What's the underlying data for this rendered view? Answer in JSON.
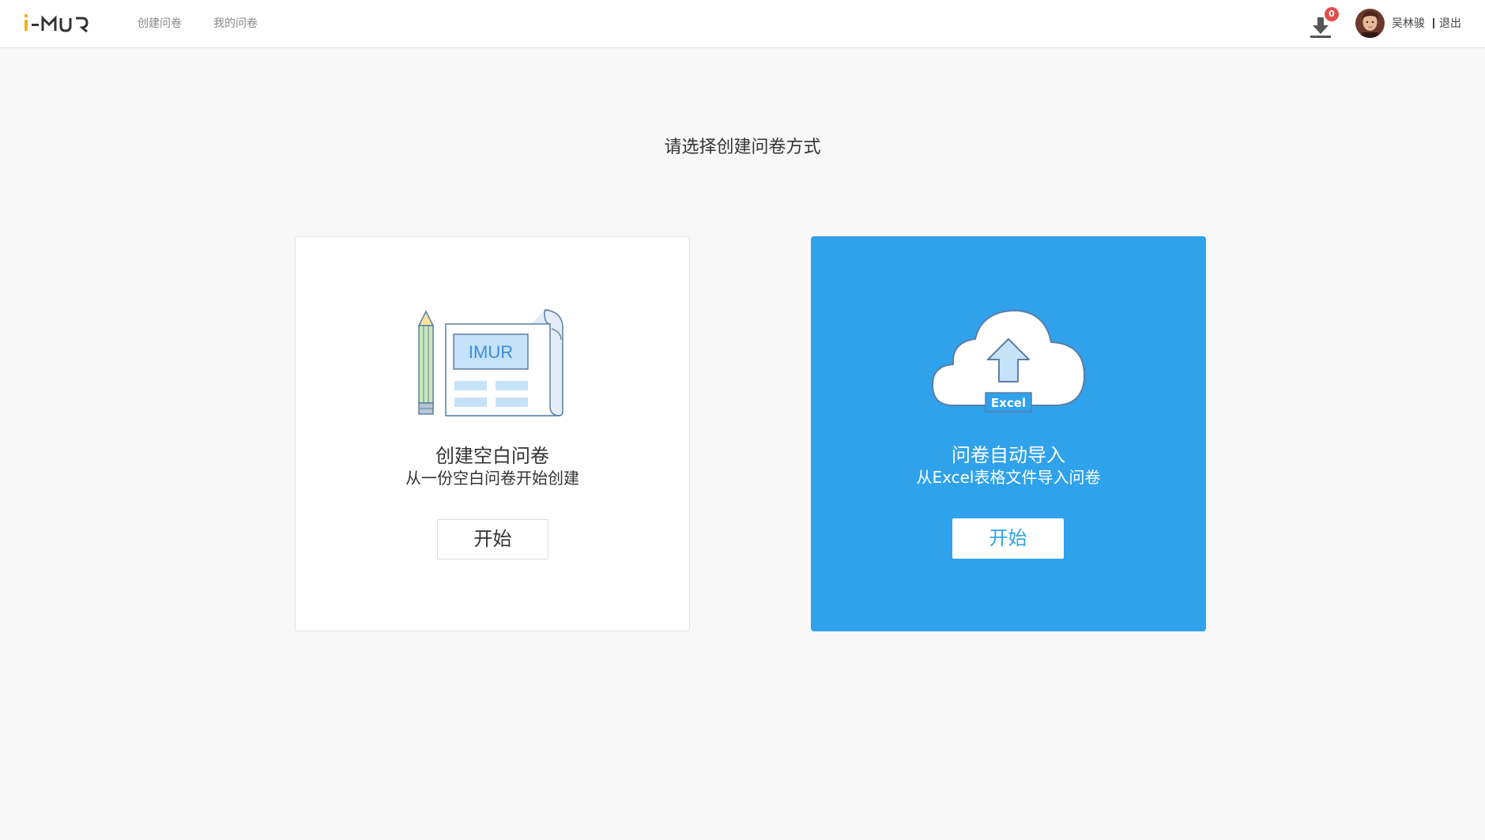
{
  "header": {
    "logo_text": "i-MUR",
    "nav": [
      {
        "label": "创建问卷"
      },
      {
        "label": "我的问卷"
      }
    ],
    "download_badge": "0",
    "user_name": "吴林骏",
    "logout_label": "退出"
  },
  "main": {
    "title": "请选择创建问卷方式",
    "cards": [
      {
        "title": "创建空白问卷",
        "subtitle": "从一份空白问卷开始创建",
        "button_label": "开始",
        "illustration_text": "IMUR"
      },
      {
        "title": "问卷自动导入",
        "subtitle": "从Excel表格文件导入问卷",
        "button_label": "开始",
        "illustration_text": "Excel"
      }
    ]
  },
  "colors": {
    "accent": "#2fa2eb",
    "badge": "#e24b4b",
    "logo_i": "#f2b01e"
  }
}
